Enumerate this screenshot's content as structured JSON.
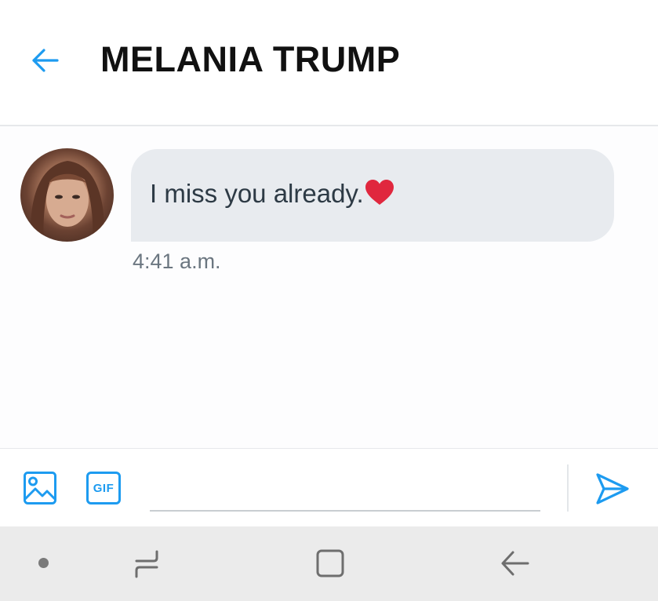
{
  "header": {
    "title": "MELANIA TRUMP",
    "back_icon": "arrow-left-icon",
    "accent_color": "#1d9bf0"
  },
  "conversation": {
    "messages": [
      {
        "text": "I miss you already.",
        "emoji_icon": "red-heart-icon",
        "timestamp": "4:41 a.m.",
        "avatar_icon": "profile-photo"
      }
    ]
  },
  "composer": {
    "media_icon": "image-icon",
    "gif_label": "GIF",
    "input_value": "",
    "input_placeholder": "",
    "send_icon": "send-icon"
  },
  "system_nav": {
    "items": [
      "dot-indicator",
      "recents-icon",
      "home-icon",
      "back-icon"
    ]
  }
}
